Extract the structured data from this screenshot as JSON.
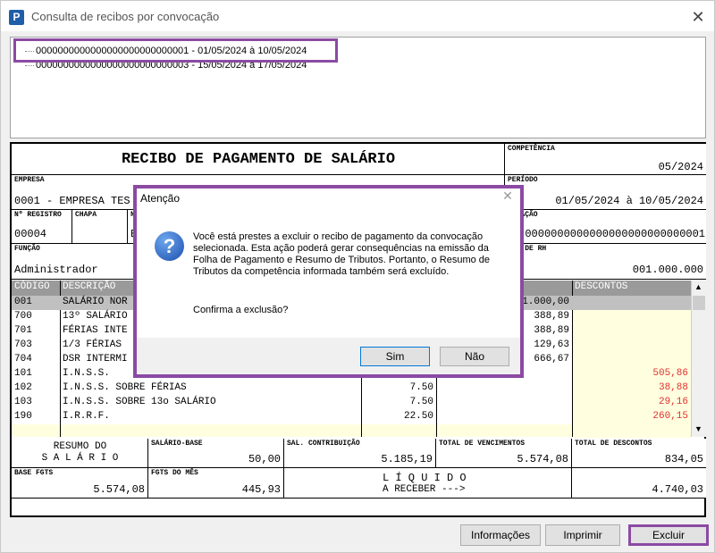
{
  "window": {
    "title": "Consulta de recibos por convocação",
    "app_icon_letter": "P",
    "close_glyph": "✕"
  },
  "tree": {
    "items": [
      {
        "label": "0000000000000000000000000001 - 01/05/2024 à 10/05/2024"
      },
      {
        "label": "0000000000000000000000000003 - 15/05/2024 à 17/05/2024"
      }
    ]
  },
  "receipt": {
    "title": "RECIBO DE PAGAMENTO DE SALÁRIO",
    "competencia_label": "COMPETÊNCIA",
    "competencia": "05/2024",
    "empresa_label": "EMPRESA",
    "empresa": "0001 - EMPRESA TES",
    "periodo_label": "PERÍODO",
    "periodo": "01/05/2024 à 10/05/2024",
    "registro_label": "Nº REGISTRO",
    "registro": "00004",
    "chapa_label": "CHAPA",
    "n_label": "N",
    "n_value": "E",
    "convocacao_label": "VOCAÇÃO",
    "convocacao": "0000000000000000000000000001",
    "funcao_label": "FUNÇÃO",
    "funcao": "Administrador",
    "divisao_label": "SÃO DE RH",
    "divisao": "001.000.000",
    "grid": {
      "headers": {
        "codigo": "CÓDIGO",
        "descricao": "DESCRIÇÃO",
        "descontos": "DESCONTOS"
      },
      "rows": [
        {
          "code": "001",
          "desc": "SALÁRIO NOR",
          "ref": "",
          "venc": "1.000,00",
          "desc_val": ""
        },
        {
          "code": "700",
          "desc": "13º SALÁRIO",
          "ref": "",
          "venc": "388,89",
          "desc_val": ""
        },
        {
          "code": "701",
          "desc": "FÉRIAS INTE",
          "ref": "",
          "venc": "388,89",
          "desc_val": ""
        },
        {
          "code": "703",
          "desc": "1/3 FÉRIAS",
          "ref": "",
          "venc": "129,63",
          "desc_val": ""
        },
        {
          "code": "704",
          "desc": "DSR INTERMI",
          "ref": "",
          "venc": "666,67",
          "desc_val": ""
        },
        {
          "code": "101",
          "desc": "I.N.S.S.",
          "ref": "",
          "venc": "",
          "desc_val": "505,86"
        },
        {
          "code": "102",
          "desc": "I.N.S.S. SOBRE FÉRIAS",
          "ref": "7.50",
          "venc": "",
          "desc_val": "38,88"
        },
        {
          "code": "103",
          "desc": "I.N.S.S. SOBRE 13o SALÁRIO",
          "ref": "7.50",
          "venc": "",
          "desc_val": "29,16"
        },
        {
          "code": "190",
          "desc": "I.R.R.F.",
          "ref": "22.50",
          "venc": "",
          "desc_val": "260,15"
        }
      ]
    },
    "resumo_l1": "RESUMO DO",
    "resumo_l2": "S A L Á R I O",
    "salario_base_label": "SALÁRIO-BASE",
    "salario_base": "50,00",
    "sal_contrib_label": "SAL. CONTRIBUIÇÃO",
    "sal_contrib": "5.185,19",
    "total_venc_label": "TOTAL DE VENCIMENTOS",
    "total_venc": "5.574,08",
    "total_desc_label": "TOTAL DE DESCONTOS",
    "total_desc": "834,05",
    "base_fgts_label": "BASE FGTS",
    "base_fgts": "5.574,08",
    "fgts_mes_label": "FGTS DO MÊS",
    "fgts_mes": "445,93",
    "liquido_l1": "L Í Q U I D O",
    "liquido_l2": "A RECEBER --->",
    "liquido": "4.740,03"
  },
  "dialog": {
    "title": "Atenção",
    "close_glyph": "✕",
    "icon_glyph": "?",
    "message": "Você está prestes a excluir o recibo de pagamento da convocação selecionada. Esta ação poderá gerar consequências na emissão da Folha de Pagamento e Resumo de Tributos. Portanto, o Resumo de Tributos da competência informada também será excluído.",
    "confirm": "Confirma a exclusão?",
    "yes": "Sim",
    "no": "Não"
  },
  "buttons": {
    "info": "Informações",
    "print": "Imprimir",
    "delete": "Excluir"
  },
  "colors": {
    "accent_highlight": "#8b4aa3",
    "discount_red": "#e03030",
    "row_yellow": "#ffffe0",
    "row_selected": "#c0c0c0"
  }
}
